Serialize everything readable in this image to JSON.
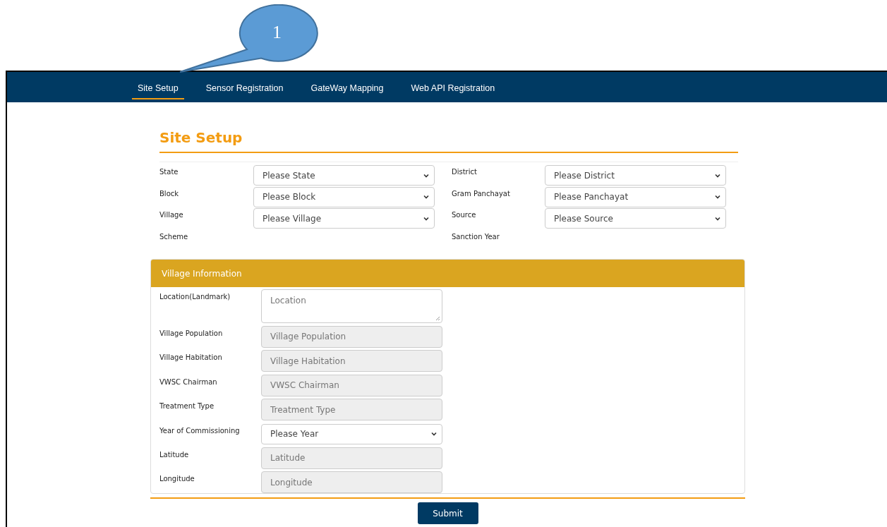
{
  "callout": {
    "label": "1"
  },
  "nav": {
    "tabs": [
      {
        "label": "Site Setup",
        "selected": true
      },
      {
        "label": "Sensor Registration",
        "selected": false
      },
      {
        "label": "GateWay Mapping",
        "selected": false
      },
      {
        "label": "Web API Registration",
        "selected": false
      }
    ]
  },
  "heading": "Site Setup",
  "site_fields": [
    {
      "label": "State",
      "kind": "select",
      "value": "Please State"
    },
    {
      "label": "District",
      "kind": "select",
      "value": "Please District"
    },
    {
      "label": "Block",
      "kind": "select",
      "value": "Please Block"
    },
    {
      "label": "Gram Panchayat",
      "kind": "select",
      "value": "Please Panchayat"
    },
    {
      "label": "Village",
      "kind": "select",
      "value": "Please Village"
    },
    {
      "label": "Source",
      "kind": "select",
      "value": "Please Source"
    },
    {
      "label": "Scheme",
      "kind": "none"
    },
    {
      "label": "Sanction Year",
      "kind": "none"
    }
  ],
  "village_panel": {
    "title": "Village Information",
    "fields": [
      {
        "label": "Location(Landmark)",
        "kind": "textarea",
        "placeholder": "Location",
        "disabled": false
      },
      {
        "label": "Village Population",
        "kind": "input",
        "placeholder": "Village Population",
        "disabled": true
      },
      {
        "label": "Village Habitation",
        "kind": "input",
        "placeholder": "Village Habitation",
        "disabled": true
      },
      {
        "label": "VWSC Chairman",
        "kind": "input",
        "placeholder": "VWSC Chairman",
        "disabled": true
      },
      {
        "label": "Treatment Type",
        "kind": "input",
        "placeholder": "Treatment Type",
        "disabled": true
      },
      {
        "label": "Year of Commissioning",
        "kind": "select",
        "value": "Please Year"
      },
      {
        "label": "Latitude",
        "kind": "input",
        "placeholder": "Latitude",
        "disabled": true
      },
      {
        "label": "Longitude",
        "kind": "input",
        "placeholder": "Longitude",
        "disabled": true
      }
    ]
  },
  "submit": "Submit"
}
